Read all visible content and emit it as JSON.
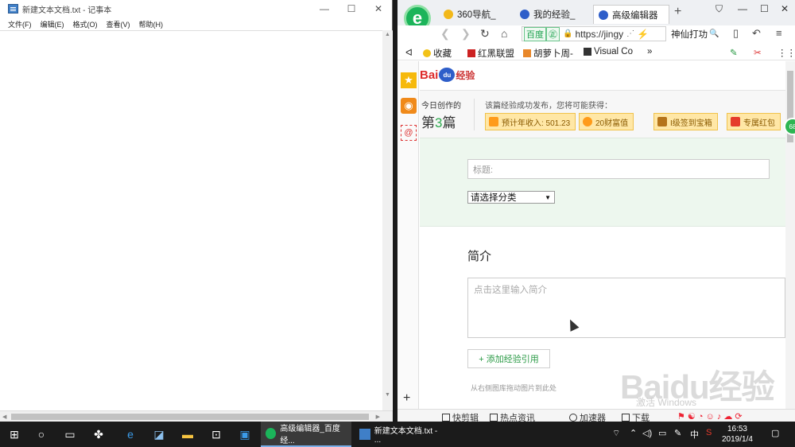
{
  "notepad": {
    "title": "新建文本文档.txt - 记事本",
    "menu": [
      "文件(F)",
      "编辑(E)",
      "格式(O)",
      "查看(V)",
      "帮助(H)"
    ],
    "controls": {
      "minimize": "—",
      "maximize": "☐",
      "close": "✕"
    }
  },
  "browser": {
    "tabs": [
      {
        "label": "360导航_",
        "icon_color": "#f2b81a"
      },
      {
        "label": "我的经验_",
        "icon_color": "#2e5ec9"
      },
      {
        "label": "高级编辑器",
        "icon_color": "#2e5ec9",
        "active": true
      }
    ],
    "new_tab": "+",
    "window_controls": {
      "skin": "⛉",
      "minimize": "—",
      "maximize": "☐",
      "close": "✕"
    },
    "nav": {
      "back": "❮",
      "forward": "❯",
      "refresh": "↻",
      "home": "⌂"
    },
    "address": {
      "badge": "百度",
      "badge_sub": "㊣",
      "url": "https://jingy",
      "extra": "⚡"
    },
    "search": {
      "text": "神仙打功",
      "icon": "🔍"
    },
    "bookmarks": [
      {
        "label": "收藏",
        "icon": "star-icon"
      },
      {
        "label": "红黑联盟",
        "icon": "shield-icon"
      },
      {
        "label": "胡萝卜周-",
        "icon": "carrot-icon"
      },
      {
        "label": "Visual Co",
        "icon": "vs-icon"
      }
    ],
    "bookmark_more": "»",
    "bookmark_collapse": "ᐊ"
  },
  "page": {
    "logo_text": "Bai",
    "logo_paw": "du",
    "logo_suffix": "经验",
    "today_label": "今日创作的",
    "nth_prefix": "第",
    "nth_num": "3",
    "nth_suffix": "篇",
    "published_msg": "该篇经验成功发布，您将可能获得：",
    "rewards": [
      "预计年收入: 501.23",
      "20财富值",
      "I级签到宝箱",
      "专属红包"
    ],
    "title_placeholder": "标题:",
    "category_select": "请选择分类",
    "intro_heading": "简介",
    "intro_placeholder": "点击这里输入简介",
    "add_reference": "+ 添加经验引用",
    "drag_hint": "从右侧图库拖动图片到此处",
    "watermark": "Baidu经验",
    "watermark_sub": "激活 Windows",
    "side_badge": "68"
  },
  "statusbar": {
    "items": [
      "快剪辑",
      "热点资讯",
      "加速器",
      "下载"
    ]
  },
  "taskbar": {
    "apps": [
      {
        "label": "高级编辑器_百度经...",
        "active": true
      },
      {
        "label": "新建文本文档.txt - ...",
        "active": false
      }
    ],
    "ime": "中",
    "time": "16:53",
    "date": "2019/1/4"
  }
}
